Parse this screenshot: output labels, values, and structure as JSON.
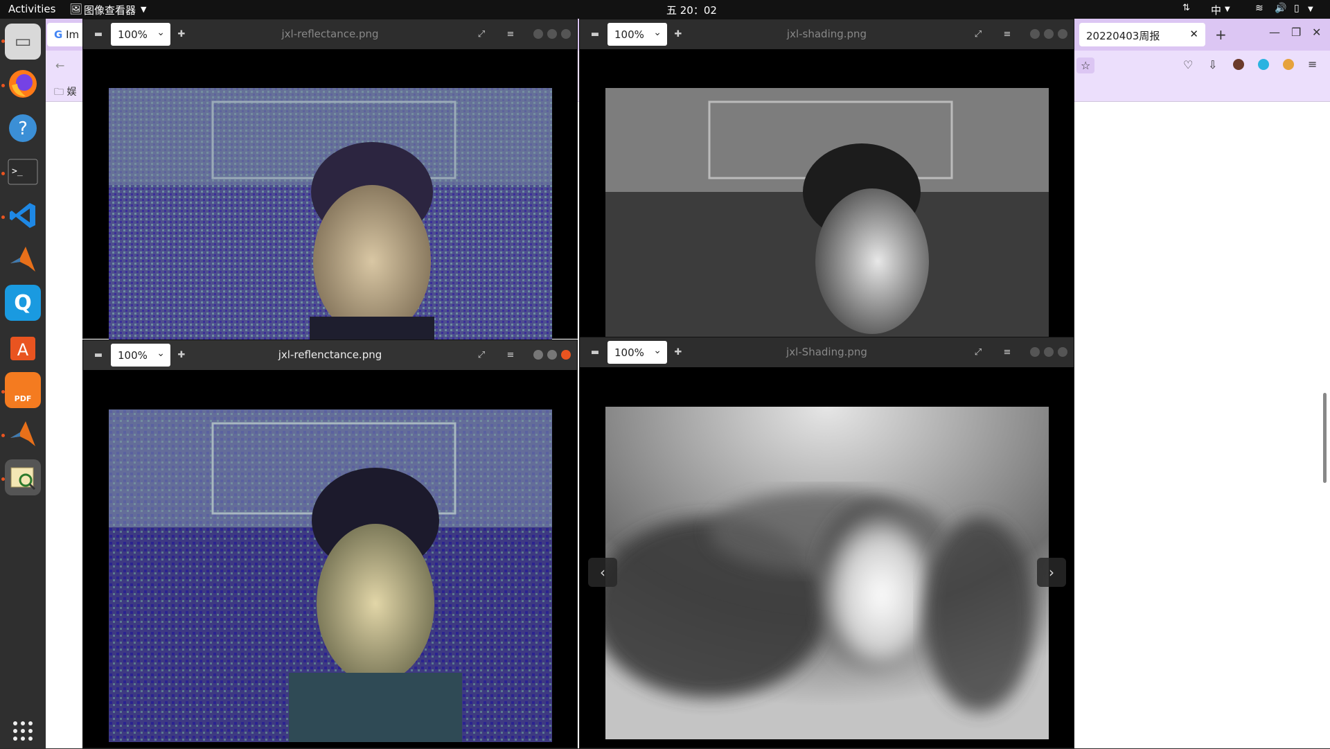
{
  "topbar": {
    "activities": "Activities",
    "app_menu": "图像查看器",
    "clock": "五 20：02",
    "input_method": "中"
  },
  "firefox": {
    "tab_left_label": "Im",
    "tab_active_label": "20220403周报",
    "bookmark_label": "娱"
  },
  "windows": {
    "w1": {
      "title": "jxl-reflectance.png",
      "zoom": "100%"
    },
    "w2": {
      "title": "jxl-shading.png",
      "zoom": "100%"
    },
    "w3": {
      "title": "jxl-reflenctance.png",
      "zoom": "100%"
    },
    "w4": {
      "title": "jxl-Shading.png",
      "zoom": "100%"
    }
  },
  "dock": {
    "items": [
      "files-icon",
      "firefox-icon",
      "help-icon",
      "terminal-icon",
      "vscode-icon",
      "matlab-icon",
      "qq-icon",
      "app-store-icon",
      "pdf-icon",
      "matlab2-icon",
      "image-viewer-icon"
    ]
  },
  "colors": {
    "accent": "#e95420",
    "firefox_tabbar": "#dcc6f3"
  }
}
